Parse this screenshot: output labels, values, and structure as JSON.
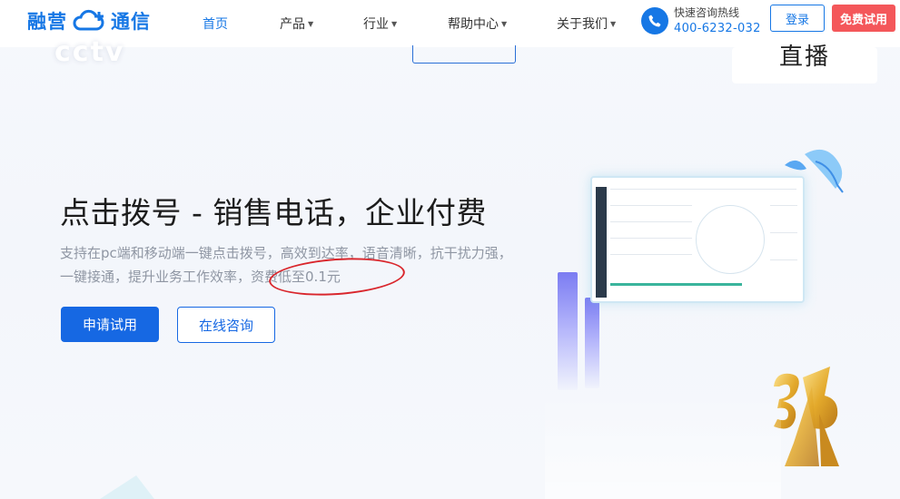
{
  "header": {
    "logo_text_1": "融营",
    "logo_text_2": "通信",
    "nav": [
      {
        "label": "首页",
        "active": true,
        "has_dropdown": false
      },
      {
        "label": "产品",
        "active": false,
        "has_dropdown": true
      },
      {
        "label": "行业",
        "active": false,
        "has_dropdown": true
      },
      {
        "label": "帮助中心",
        "active": false,
        "has_dropdown": true
      },
      {
        "label": "关于我们",
        "active": false,
        "has_dropdown": true
      }
    ],
    "hotline_label": "快速咨询热线",
    "hotline_number": "400-6232-032",
    "login_label": "登录",
    "trial_label": "免费试用"
  },
  "banner": {
    "watermark": "cctv",
    "live_label": "直播"
  },
  "hero": {
    "title": "点击拨号 - 销售电话，企业付费",
    "description": "支持在pc端和移动端一键点击拨号，高效到达率，语音清晰，抗干扰力强，一键接通，提升业务工作效率，资费低至0.1元",
    "apply_label": "申请试用",
    "consult_label": "在线咨询"
  },
  "colors": {
    "brand": "#1677e5",
    "trial_red": "#f4575a",
    "highlight_ring": "#d9262c",
    "apply_blue": "#1668e3"
  }
}
